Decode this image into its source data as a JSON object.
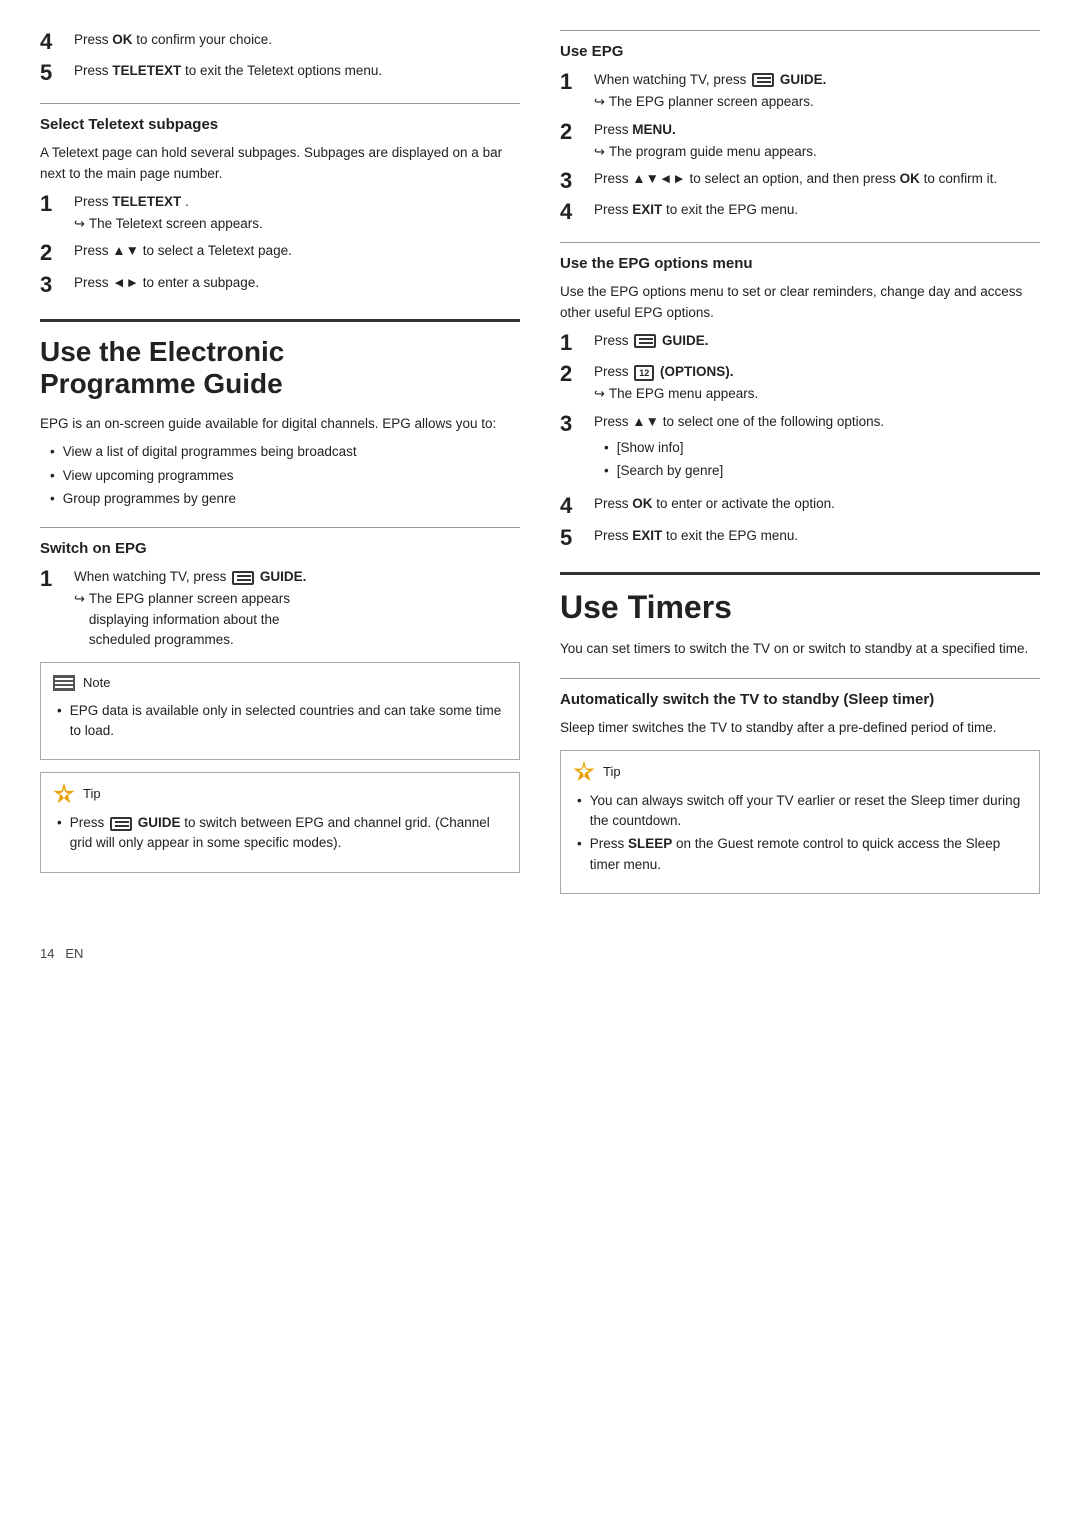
{
  "left": {
    "step4_label": "4",
    "step4_text": "Press ",
    "step4_bold": "OK",
    "step4_rest": " to confirm your choice.",
    "step5_label": "5",
    "step5_text": "Press ",
    "step5_bold": "TELETEXT",
    "step5_rest": " to exit the Teletext options menu.",
    "select_subpages_title": "Select Teletext subpages",
    "subpages_para": "A Teletext page can hold several subpages. Subpages are displayed on a bar next to the main page number.",
    "sub_step1_label": "1",
    "sub_step1_text": "Press ",
    "sub_step1_bold": "TELETEXT",
    "sub_step1_rest": " .",
    "sub_step1_arrow": "The Teletext screen appears.",
    "sub_step2_label": "2",
    "sub_step2_text": "Press ▲▼ to select a Teletext page.",
    "sub_step3_label": "3",
    "sub_step3_text": "Press ◄► to enter a subpage.",
    "epg_big_title_line1": "Use the Electronic",
    "epg_big_title_line2": "Programme Guide",
    "epg_intro": "EPG is an on-screen guide available for digital channels. EPG allows you to:",
    "epg_bullets": [
      "View a list of digital programmes being broadcast",
      "View upcoming programmes",
      "Group programmes by genre"
    ],
    "switch_on_epg_title": "Switch on EPG",
    "switch_step1_label": "1",
    "switch_step1_text": "When watching TV, press",
    "switch_step1_bold": "GUIDE.",
    "switch_step1_arrow1": "The EPG planner screen appears",
    "switch_step1_arrow2": "displaying information about the",
    "switch_step1_arrow3": "scheduled programmes.",
    "note_label": "Note",
    "note_bullet": "EPG data is available only in selected countries and can take some time to load.",
    "tip_label": "Tip",
    "tip_bullet1_text": "Press",
    "tip_bullet1_bold": "GUIDE",
    "tip_bullet1_rest": " to switch between EPG and channel grid. (Channel grid will only appear in some specific modes)."
  },
  "right": {
    "use_epg_title": "Use EPG",
    "r_step1_label": "1",
    "r_step1_text": "When watching TV, press",
    "r_step1_bold": "GUIDE.",
    "r_step1_arrow": "The EPG planner screen appears.",
    "r_step2_label": "2",
    "r_step2_text": "Press ",
    "r_step2_bold": "MENU.",
    "r_step2_arrow": "The program guide menu appears.",
    "r_step3_label": "3",
    "r_step3_text": "Press ▲▼◄► to select an option, and then press",
    "r_step3_bold": "OK",
    "r_step3_rest": "to confirm it.",
    "r_step4_label": "4",
    "r_step4_text": "Press ",
    "r_step4_bold": "EXIT",
    "r_step4_rest": " to exit the EPG menu.",
    "epg_options_title": "Use the EPG options menu",
    "epg_options_para": "Use the EPG options menu to set or clear reminders, change day and access other useful EPG options.",
    "opt_step1_label": "1",
    "opt_step1_text": "Press",
    "opt_step1_bold": "GUIDE.",
    "opt_step2_label": "2",
    "opt_step2_text": "Press",
    "opt_step2_bold": "(OPTIONS).",
    "opt_step2_arrow": "The EPG menu appears.",
    "opt_step3_label": "3",
    "opt_step3_text": "Press ▲▼ to select one of the following options.",
    "opt_bullets": [
      "[Show info]",
      "[Search by genre]"
    ],
    "opt_step4_label": "4",
    "opt_step4_text": "Press ",
    "opt_step4_bold": "OK",
    "opt_step4_rest": " to enter or activate the option.",
    "opt_step5_label": "5",
    "opt_step5_text": "Press ",
    "opt_step5_bold": "EXIT",
    "opt_step5_rest": " to exit the EPG menu.",
    "timers_big_title": "Use Timers",
    "timers_intro": "You can set timers to switch the TV on or switch to standby at a specified time.",
    "sleep_title": "Automatically switch the TV to standby (Sleep timer)",
    "sleep_para": "Sleep timer switches the TV to standby after a pre-defined period of time.",
    "sleep_tip_label": "Tip",
    "sleep_tip_bullet1": "You can always switch off your TV earlier or reset the Sleep timer during the countdown.",
    "sleep_tip_bullet2_text": "Press",
    "sleep_tip_bullet2_bold": "SLEEP",
    "sleep_tip_bullet2_rest": " on the Guest remote control to quick access the Sleep timer menu."
  },
  "footer": {
    "page_num": "14",
    "lang": "EN"
  }
}
